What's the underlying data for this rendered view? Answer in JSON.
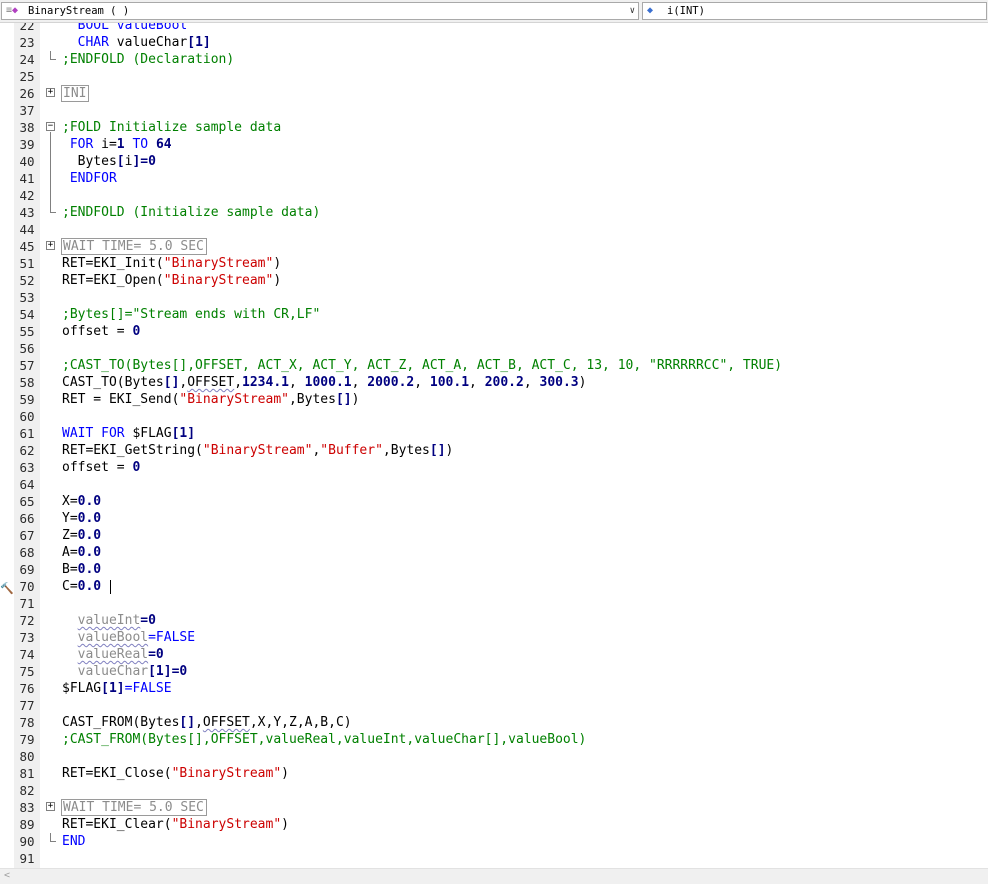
{
  "header": {
    "left_icon": "module-icon",
    "left_text": "BinaryStream ( )",
    "right_icon": "variable-icon",
    "right_text": "i(INT)"
  },
  "colors": {
    "keyword": "#0000ff",
    "number": "#000080",
    "string": "#cc0000",
    "comment": "#008000",
    "grayed": "#8c8c8c"
  },
  "lines": [
    {
      "n": "22",
      "tokens": [
        {
          "t": "  BOOL valueBool",
          "c": "kw"
        }
      ]
    },
    {
      "n": "23",
      "tokens": [
        {
          "t": "  CHAR ",
          "c": "kw"
        },
        {
          "t": "valueChar",
          "c": ""
        },
        {
          "t": "[1]",
          "c": "num"
        }
      ]
    },
    {
      "n": "24",
      "tokens": [
        {
          "t": ";ENDFOLD (Declaration)",
          "c": "cm"
        }
      ]
    },
    {
      "n": "25",
      "tokens": []
    },
    {
      "n": "26",
      "tokens": [
        {
          "t": "INI",
          "c": "fold"
        }
      ]
    },
    {
      "n": "37",
      "tokens": []
    },
    {
      "n": "38",
      "tokens": [
        {
          "t": ";FOLD Initialize sample data",
          "c": "cm"
        }
      ]
    },
    {
      "n": "39",
      "tokens": [
        {
          "t": " FOR ",
          "c": "kw"
        },
        {
          "t": "i=",
          "c": ""
        },
        {
          "t": "1",
          "c": "num"
        },
        {
          "t": " TO ",
          "c": "kw"
        },
        {
          "t": "64",
          "c": "num"
        }
      ]
    },
    {
      "n": "40",
      "tokens": [
        {
          "t": "  Bytes",
          "c": ""
        },
        {
          "t": "[",
          "c": "bold"
        },
        {
          "t": "i",
          "c": ""
        },
        {
          "t": "]",
          "c": "bold"
        },
        {
          "t": "=0",
          "c": "num"
        }
      ]
    },
    {
      "n": "41",
      "tokens": [
        {
          "t": " ENDFOR",
          "c": "kw"
        }
      ]
    },
    {
      "n": "42",
      "tokens": []
    },
    {
      "n": "43",
      "tokens": [
        {
          "t": ";ENDFOLD (Initialize sample data)",
          "c": "cm"
        }
      ]
    },
    {
      "n": "44",
      "tokens": []
    },
    {
      "n": "45",
      "tokens": [
        {
          "t": "WAIT TIME= 5.0 SEC",
          "c": "fold"
        }
      ]
    },
    {
      "n": "51",
      "tokens": [
        {
          "t": "RET=EKI_Init(",
          "c": ""
        },
        {
          "t": "\"BinaryStream\"",
          "c": "str"
        },
        {
          "t": ")",
          "c": ""
        }
      ]
    },
    {
      "n": "52",
      "tokens": [
        {
          "t": "RET=EKI_Open(",
          "c": ""
        },
        {
          "t": "\"BinaryStream\"",
          "c": "str"
        },
        {
          "t": ")",
          "c": ""
        }
      ]
    },
    {
      "n": "53",
      "tokens": []
    },
    {
      "n": "54",
      "tokens": [
        {
          "t": ";Bytes[]=\"Stream ends with CR,LF\"",
          "c": "cm"
        }
      ]
    },
    {
      "n": "55",
      "tokens": [
        {
          "t": "offset = ",
          "c": ""
        },
        {
          "t": "0",
          "c": "num"
        }
      ]
    },
    {
      "n": "56",
      "tokens": []
    },
    {
      "n": "57",
      "tokens": [
        {
          "t": ";CAST_TO(Bytes[],OFFSET, ACT_X, ACT_Y, ACT_Z, ACT_A, ACT_B, ACT_C, 13, 10, \"RRRRRRCC\", TRUE)",
          "c": "cm"
        }
      ]
    },
    {
      "n": "58",
      "tokens": [
        {
          "t": "CAST_TO(Bytes",
          "c": ""
        },
        {
          "t": "[]",
          "c": "bold"
        },
        {
          "t": ",",
          "c": ""
        },
        {
          "t": "OFFSET",
          "c": "sq"
        },
        {
          "t": ",",
          "c": ""
        },
        {
          "t": "1234.1",
          "c": "num"
        },
        {
          "t": ", ",
          "c": ""
        },
        {
          "t": "1000.1",
          "c": "num"
        },
        {
          "t": ", ",
          "c": ""
        },
        {
          "t": "2000.2",
          "c": "num"
        },
        {
          "t": ", ",
          "c": ""
        },
        {
          "t": "100.1",
          "c": "num"
        },
        {
          "t": ", ",
          "c": ""
        },
        {
          "t": "200.2",
          "c": "num"
        },
        {
          "t": ", ",
          "c": ""
        },
        {
          "t": "300.3",
          "c": "num"
        },
        {
          "t": ")",
          "c": ""
        }
      ]
    },
    {
      "n": "59",
      "tokens": [
        {
          "t": "RET = EKI_Send(",
          "c": ""
        },
        {
          "t": "\"BinaryStream\"",
          "c": "str"
        },
        {
          "t": ",Bytes",
          "c": ""
        },
        {
          "t": "[]",
          "c": "bold"
        },
        {
          "t": ")",
          "c": ""
        }
      ]
    },
    {
      "n": "60",
      "tokens": []
    },
    {
      "n": "61",
      "tokens": [
        {
          "t": "WAIT FOR ",
          "c": "kw"
        },
        {
          "t": "$FLAG",
          "c": ""
        },
        {
          "t": "[1]",
          "c": "num"
        }
      ]
    },
    {
      "n": "62",
      "tokens": [
        {
          "t": "RET=EKI_GetString(",
          "c": ""
        },
        {
          "t": "\"BinaryStream\"",
          "c": "str"
        },
        {
          "t": ",",
          "c": ""
        },
        {
          "t": "\"Buffer\"",
          "c": "str"
        },
        {
          "t": ",Bytes",
          "c": ""
        },
        {
          "t": "[]",
          "c": "bold"
        },
        {
          "t": ")",
          "c": ""
        }
      ]
    },
    {
      "n": "63",
      "tokens": [
        {
          "t": "offset = ",
          "c": ""
        },
        {
          "t": "0",
          "c": "num"
        }
      ]
    },
    {
      "n": "64",
      "tokens": []
    },
    {
      "n": "65",
      "tokens": [
        {
          "t": "X=",
          "c": ""
        },
        {
          "t": "0.0",
          "c": "num"
        }
      ]
    },
    {
      "n": "66",
      "tokens": [
        {
          "t": "Y=",
          "c": ""
        },
        {
          "t": "0.0",
          "c": "num"
        }
      ]
    },
    {
      "n": "67",
      "tokens": [
        {
          "t": "Z=",
          "c": ""
        },
        {
          "t": "0.0",
          "c": "num"
        }
      ]
    },
    {
      "n": "68",
      "tokens": [
        {
          "t": "A=",
          "c": ""
        },
        {
          "t": "0.0",
          "c": "num"
        }
      ]
    },
    {
      "n": "69",
      "tokens": [
        {
          "t": "B=",
          "c": ""
        },
        {
          "t": "0.0",
          "c": "num"
        }
      ]
    },
    {
      "n": "70",
      "tokens": [
        {
          "t": "C=",
          "c": ""
        },
        {
          "t": "0.0",
          "c": "num"
        },
        {
          "t": " ",
          "c": ""
        }
      ],
      "cursor": true,
      "marker": "hammer-icon"
    },
    {
      "n": "71",
      "tokens": []
    },
    {
      "n": "72",
      "tokens": [
        {
          "t": "  ",
          "c": ""
        },
        {
          "t": "valueInt",
          "c": "grsq"
        },
        {
          "t": "=0",
          "c": "num"
        }
      ]
    },
    {
      "n": "73",
      "tokens": [
        {
          "t": "  ",
          "c": ""
        },
        {
          "t": "valueBool",
          "c": "grsq"
        },
        {
          "t": "=FALSE",
          "c": "kw"
        }
      ]
    },
    {
      "n": "74",
      "tokens": [
        {
          "t": "  ",
          "c": ""
        },
        {
          "t": "valueReal",
          "c": "grsq"
        },
        {
          "t": "=0",
          "c": "num"
        }
      ]
    },
    {
      "n": "75",
      "tokens": [
        {
          "t": "  ",
          "c": ""
        },
        {
          "t": "valueChar",
          "c": "gr"
        },
        {
          "t": "[1]=0",
          "c": "num"
        }
      ]
    },
    {
      "n": "76",
      "tokens": [
        {
          "t": "$FLAG",
          "c": ""
        },
        {
          "t": "[1]",
          "c": "num"
        },
        {
          "t": "=FALSE",
          "c": "kw"
        }
      ]
    },
    {
      "n": "77",
      "tokens": []
    },
    {
      "n": "78",
      "tokens": [
        {
          "t": "CAST_FROM(Bytes",
          "c": ""
        },
        {
          "t": "[]",
          "c": "bold"
        },
        {
          "t": ",",
          "c": ""
        },
        {
          "t": "OFFSET",
          "c": "sq"
        },
        {
          "t": ",X,Y,Z,A,B,C)",
          "c": ""
        }
      ]
    },
    {
      "n": "79",
      "tokens": [
        {
          "t": ";CAST_FROM(Bytes[],OFFSET,valueReal,valueInt,valueChar[],valueBool)",
          "c": "cm"
        }
      ]
    },
    {
      "n": "80",
      "tokens": []
    },
    {
      "n": "81",
      "tokens": [
        {
          "t": "RET=EKI_Close(",
          "c": ""
        },
        {
          "t": "\"BinaryStream\"",
          "c": "str"
        },
        {
          "t": ")",
          "c": ""
        }
      ]
    },
    {
      "n": "82",
      "tokens": []
    },
    {
      "n": "83",
      "tokens": [
        {
          "t": "WAIT TIME= 5.0 SEC",
          "c": "fold"
        }
      ]
    },
    {
      "n": "89",
      "tokens": [
        {
          "t": "RET=EKI_Clear(",
          "c": ""
        },
        {
          "t": "\"BinaryStream\"",
          "c": "str"
        },
        {
          "t": ")",
          "c": ""
        }
      ]
    },
    {
      "n": "90",
      "tokens": [
        {
          "t": "END",
          "c": "kw"
        }
      ]
    },
    {
      "n": "91",
      "tokens": []
    }
  ]
}
